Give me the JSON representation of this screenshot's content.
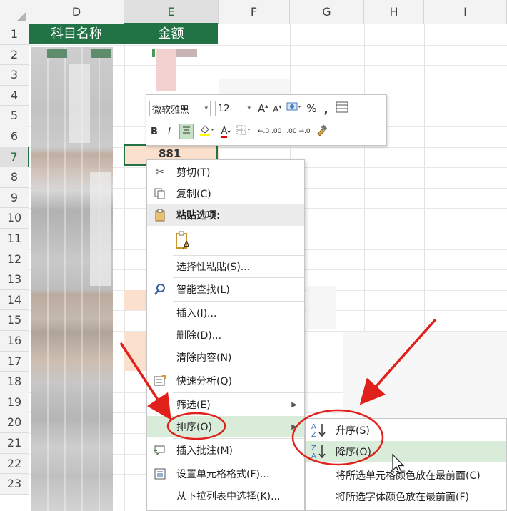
{
  "columns": [
    "D",
    "E",
    "F",
    "G",
    "H",
    "I"
  ],
  "rows": [
    "1",
    "2",
    "3",
    "4",
    "5",
    "6",
    "7",
    "8",
    "9",
    "10",
    "11",
    "12",
    "13",
    "14",
    "15",
    "16",
    "17",
    "18",
    "19",
    "20",
    "21",
    "22",
    "23"
  ],
  "header_cells": {
    "d1": "科目名称",
    "e1": "金额"
  },
  "partial_value": "881",
  "mini_toolbar": {
    "font_name": "微软雅黑",
    "font_size": "12",
    "grow_font": "A",
    "shrink_font": "A",
    "percent": "%",
    "comma": ",",
    "bold": "B",
    "italic": "I",
    "font_color_glyph": "A",
    "increase_decimal": "←.0 .00",
    "decrease_decimal": ".00 →.0"
  },
  "context_menu": {
    "cut": "剪切(T)",
    "copy": "复制(C)",
    "paste_options": "粘贴选项:",
    "paste_special": "选择性粘贴(S)...",
    "smart_lookup": "智能查找(L)",
    "insert": "插入(I)...",
    "delete": "删除(D)...",
    "clear_contents": "清除内容(N)",
    "quick_analysis": "快速分析(Q)",
    "filter": "筛选(E)",
    "sort": "排序(O)",
    "insert_comment": "插入批注(M)",
    "format_cells": "设置单元格格式(F)...",
    "pick_from_list": "从下拉列表中选择(K)..."
  },
  "sort_submenu": {
    "ascending": "升序(S)",
    "descending": "降序(O)",
    "cell_color_top": "将所选单元格颜色放在最前面(C)",
    "font_color_top": "将所选字体颜色放在最前面(F)"
  },
  "colors": {
    "excel_green": "#217346",
    "highlight": "#d9ecd9",
    "annotation_red": "#e0201b"
  }
}
